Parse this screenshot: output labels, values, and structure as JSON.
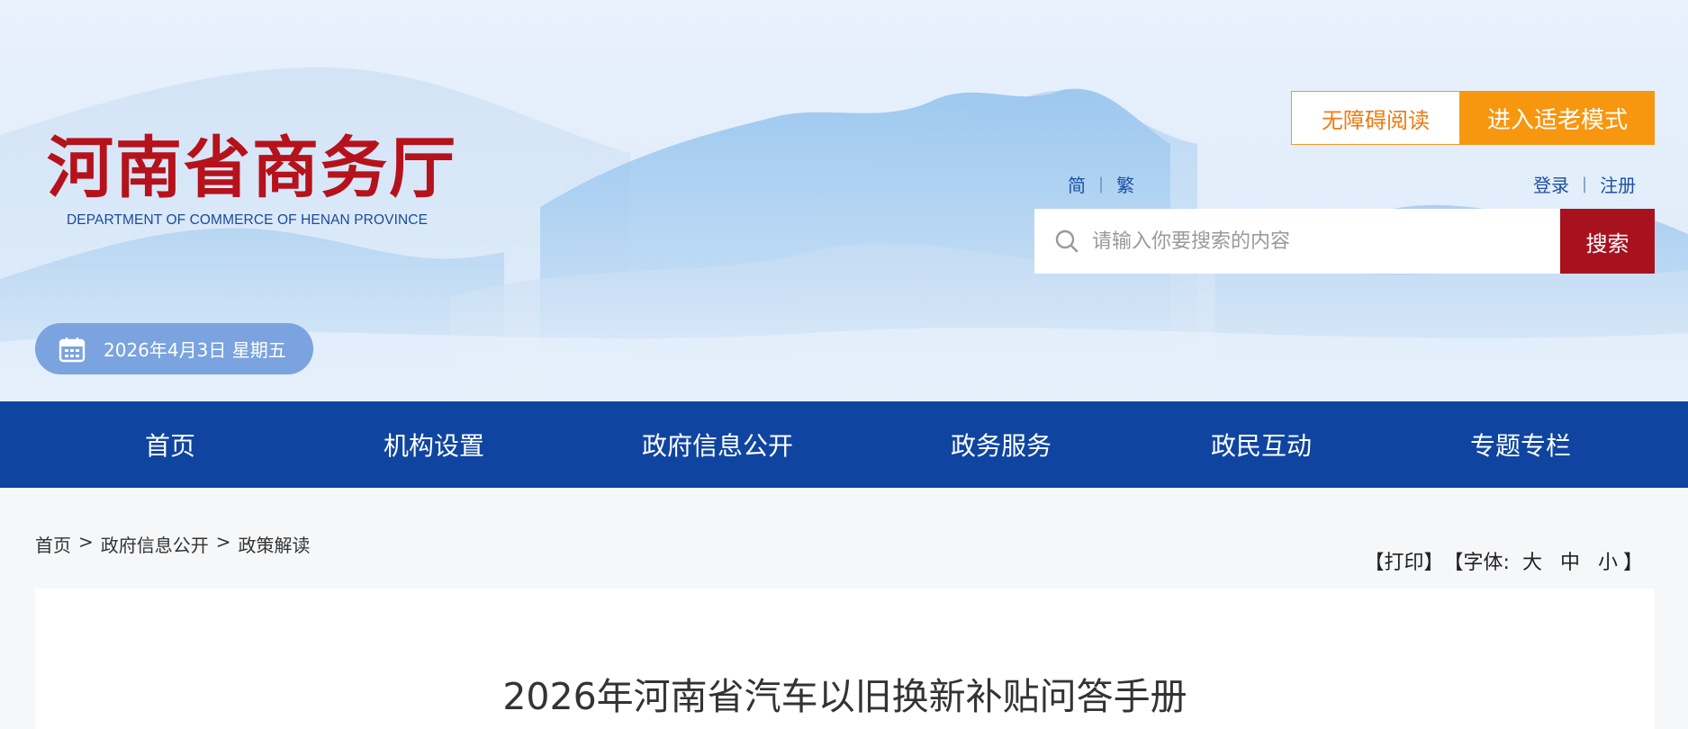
{
  "header": {
    "logo_cn": "河南省商务厅",
    "logo_en": "DEPARTMENT OF COMMERCE OF HENAN PROVINCE",
    "date": "2026年4月3日 星期五",
    "accessibility_label": "无障碍阅读",
    "elder_mode_label": "进入适老模式",
    "lang_simplified": "简",
    "lang_traditional": "繁",
    "login": "登录",
    "register": "注册",
    "separator": "|"
  },
  "search": {
    "placeholder": "请输入你要搜索的内容",
    "button": "搜索"
  },
  "nav": {
    "items": [
      {
        "label": "首页"
      },
      {
        "label": "机构设置"
      },
      {
        "label": "政府信息公开"
      },
      {
        "label": "政务服务"
      },
      {
        "label": "政民互动"
      },
      {
        "label": "专题专栏"
      }
    ]
  },
  "breadcrumb": {
    "home": "首页",
    "sep": ">",
    "level1": "政府信息公开",
    "level2": "政策解读"
  },
  "tools": {
    "print": "【打印】",
    "font_prefix": "【字体:",
    "large": "大",
    "medium": "中",
    "small": "小",
    "font_suffix": "】"
  },
  "article": {
    "title": "2026年河南省汽车以旧换新补贴问答手册"
  },
  "colors": {
    "nav_bg": "#0f45a0",
    "logo_red": "#b5121b",
    "search_btn": "#a8121f",
    "elder_btn": "#f7960f",
    "access_btn_text": "#ef7a12"
  },
  "icons": [
    "calendar-icon",
    "search-icon"
  ]
}
